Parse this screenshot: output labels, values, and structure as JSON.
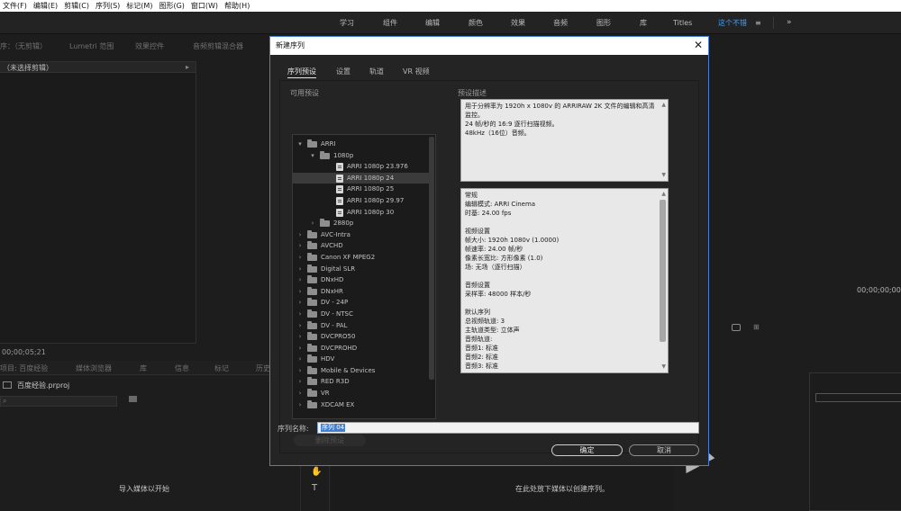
{
  "menubar": {
    "items": [
      "文件(F)",
      "编辑(E)",
      "剪辑(C)",
      "序列(S)",
      "标记(M)",
      "图形(G)",
      "窗口(W)",
      "帮助(H)"
    ]
  },
  "workspaces": {
    "tabs": [
      "学习",
      "组件",
      "编辑",
      "颜色",
      "效果",
      "音频",
      "图形",
      "库",
      "Titles",
      "这个不错"
    ],
    "active": "这个不错",
    "more": "»",
    "menu_glyph": "≡"
  },
  "source_panel": {
    "tabs": [
      "序：（无剪辑）",
      "Lumetri 范围",
      "效果控件",
      "音频剪辑混合器"
    ],
    "subtitle": "（未选择剪辑）",
    "timecode": "00;00;05;21"
  },
  "program_panel": {
    "timecode": "00;00;00;00"
  },
  "project_panel": {
    "tabs": [
      "项目: 百度经验",
      "媒体浏览器",
      "库",
      "信息",
      "标记",
      "历史"
    ],
    "filename": "百度经验.prproj",
    "empty_hint": "导入媒体以开始"
  },
  "timeline_panel": {
    "empty_hint": "在此处放下媒体以创建序列。"
  },
  "dialog": {
    "title": "新建序列",
    "close": "✕",
    "tabs": [
      "序列预设",
      "设置",
      "轨道",
      "VR 视频"
    ],
    "active_tab": "序列预设",
    "presets_label": "可用预设",
    "description_label": "预设描述",
    "presets": [
      {
        "level": 0,
        "type": "folder",
        "expanded": true,
        "label": "ARRI"
      },
      {
        "level": 1,
        "type": "folder",
        "expanded": true,
        "label": "1080p"
      },
      {
        "level": 2,
        "type": "file",
        "label": "ARRI 1080p 23.976"
      },
      {
        "level": 2,
        "type": "file",
        "label": "ARRI 1080p 24",
        "selected": true
      },
      {
        "level": 2,
        "type": "file",
        "label": "ARRI 1080p 25"
      },
      {
        "level": 2,
        "type": "file",
        "label": "ARRI 1080p 29.97"
      },
      {
        "level": 2,
        "type": "file",
        "label": "ARRI 1080p 30"
      },
      {
        "level": 1,
        "type": "folder",
        "expanded": false,
        "label": "2880p"
      },
      {
        "level": 0,
        "type": "folder",
        "expanded": false,
        "label": "AVC-Intra"
      },
      {
        "level": 0,
        "type": "folder",
        "expanded": false,
        "label": "AVCHD"
      },
      {
        "level": 0,
        "type": "folder",
        "expanded": false,
        "label": "Canon XF MPEG2"
      },
      {
        "level": 0,
        "type": "folder",
        "expanded": false,
        "label": "Digital SLR"
      },
      {
        "level": 0,
        "type": "folder",
        "expanded": false,
        "label": "DNxHD"
      },
      {
        "level": 0,
        "type": "folder",
        "expanded": false,
        "label": "DNxHR"
      },
      {
        "level": 0,
        "type": "folder",
        "expanded": false,
        "label": "DV - 24P"
      },
      {
        "level": 0,
        "type": "folder",
        "expanded": false,
        "label": "DV - NTSC"
      },
      {
        "level": 0,
        "type": "folder",
        "expanded": false,
        "label": "DV - PAL"
      },
      {
        "level": 0,
        "type": "folder",
        "expanded": false,
        "label": "DVCPRO50"
      },
      {
        "level": 0,
        "type": "folder",
        "expanded": false,
        "label": "DVCPROHD"
      },
      {
        "level": 0,
        "type": "folder",
        "expanded": false,
        "label": "HDV"
      },
      {
        "level": 0,
        "type": "folder",
        "expanded": false,
        "label": "Mobile & Devices"
      },
      {
        "level": 0,
        "type": "folder",
        "expanded": false,
        "label": "RED R3D"
      },
      {
        "level": 0,
        "type": "folder",
        "expanded": false,
        "label": "VR"
      },
      {
        "level": 0,
        "type": "folder",
        "expanded": false,
        "label": "XDCAM EX"
      }
    ],
    "description_lines": [
      "用于分辨率为 1920h x 1080v 的 ARRIRAW 2K 文件的编辑和高清",
      "监控。",
      "24 帧/秒的 16:9 逐行扫描视频。",
      "48kHz（16位）音频。"
    ],
    "details_lines": [
      "常规",
      " 编辑模式: ARRI Cinema",
      " 时基: 24.00 fps",
      "",
      "视频设置",
      " 帧大小: 1920h 1080v (1.0000)",
      " 帧速率: 24.00  帧/秒",
      " 像素长宽比: 方形像素 (1.0)",
      " 场: 无场（逐行扫描）",
      "",
      "音频设置",
      " 采样率: 48000 样本/秒",
      "",
      "默认序列",
      " 总视频轨道: 3",
      " 主轨道类型: 立体声",
      " 音频轨道:",
      " 音频1: 标准",
      " 音频2: 标准",
      " 音频3: 标准"
    ],
    "delete_button": "删除预设",
    "name_label": "序列名称:",
    "name_value": "序列 04",
    "ok_button": "确定",
    "cancel_button": "取消"
  }
}
